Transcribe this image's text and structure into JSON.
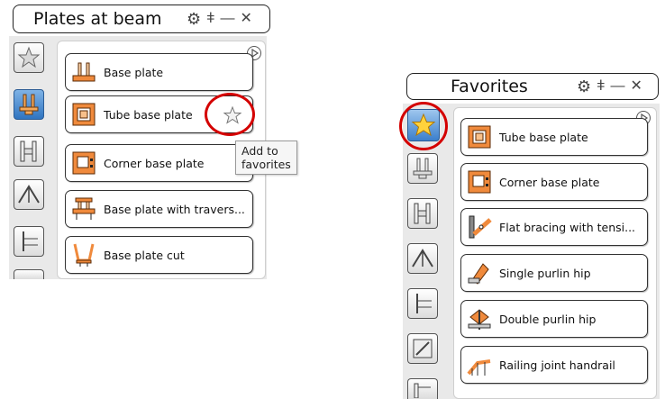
{
  "left_panel": {
    "title": "Plates at beam",
    "items": [
      {
        "label": "Base plate",
        "icon": "base-plate-icon"
      },
      {
        "label": "Tube base plate",
        "icon": "tube-base-plate-icon"
      },
      {
        "label": "Corner base plate",
        "icon": "corner-base-plate-icon"
      },
      {
        "label": "Base plate with travers...",
        "icon": "base-plate-travers-icon"
      },
      {
        "label": "Base plate cut",
        "icon": "base-plate-cut-icon"
      }
    ],
    "tooltip": "Add to favorites"
  },
  "right_panel": {
    "title": "Favorites",
    "items": [
      {
        "label": "Tube base plate",
        "icon": "tube-base-plate-icon"
      },
      {
        "label": "Corner base plate",
        "icon": "corner-base-plate-icon"
      },
      {
        "label": "Flat bracing with tensi...",
        "icon": "flat-bracing-icon"
      },
      {
        "label": "Single purlin hip",
        "icon": "single-purlin-hip-icon"
      },
      {
        "label": "Double purlin hip",
        "icon": "double-purlin-hip-icon"
      },
      {
        "label": "Railing joint handrail",
        "icon": "railing-joint-handrail-icon"
      }
    ]
  },
  "colors": {
    "accent": "#2f74c0",
    "highlight_ring": "#d40000",
    "icon_orange": "#f08a3c"
  }
}
